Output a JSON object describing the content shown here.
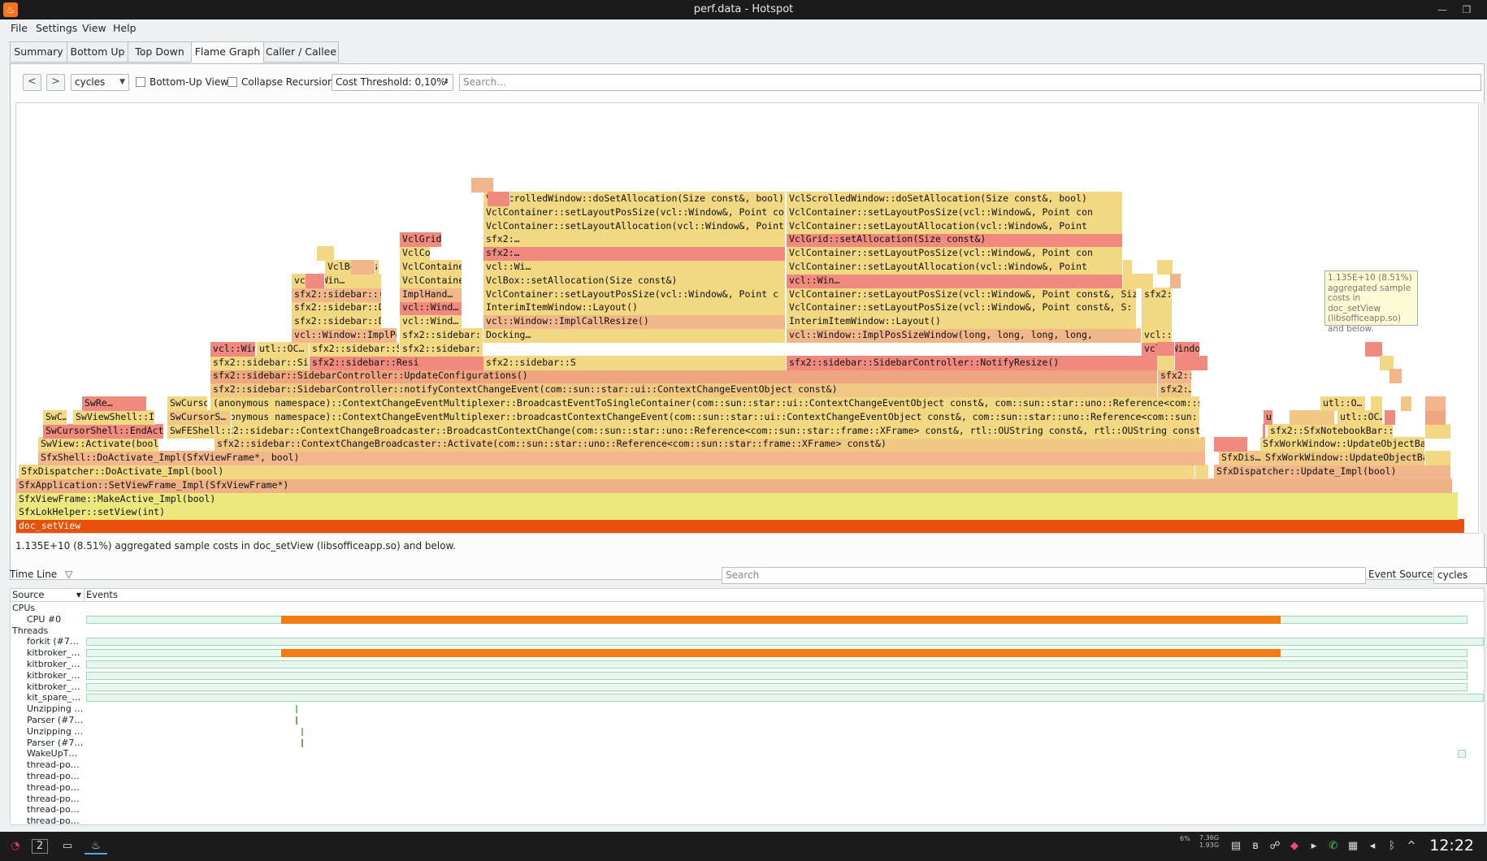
{
  "window": {
    "title": "perf.data - Hotspot"
  },
  "menubar": {
    "items": [
      "File",
      "Settings",
      "View",
      "Help"
    ]
  },
  "tabs": [
    "Summary",
    "Bottom Up",
    "Top Down",
    "Flame Graph",
    "Caller / Callee"
  ],
  "active_tab": "Flame Graph",
  "toolbar": {
    "back": "<",
    "forward": ">",
    "cost_type": "cycles",
    "bottom_up_view": "Bottom-Up View",
    "collapse_recursion": "Collapse Recursion",
    "cost_threshold": "Cost Threshold: 0,10%",
    "search_placeholder": "Search..."
  },
  "flamegraph": {
    "frames": [
      {
        "label": "doc_setView",
        "color": "#e8500c"
      },
      {
        "label": "SfxLokHelper::setView(int)",
        "color": "#ede87e"
      },
      {
        "label": "SfxViewFrame::MakeActive_Impl(bool)",
        "color": "#ede87e"
      },
      {
        "label": "SfxApplication::SetViewFrame_Impl(SfxViewFrame*)",
        "color": "#efb288"
      },
      {
        "label": "SfxDispatcher::DoActivate_Impl(bool)",
        "color": "#f2d882"
      },
      {
        "label": "SfxDispatcher::Update_Impl(bool)",
        "color": "#f1b68a"
      },
      {
        "label": "SfxShell::DoActivate_Impl(SfxViewFrame*, bool)",
        "color": "#f1b68a"
      },
      {
        "label": "sfx2::sidebar::ContextChangeBroadcaster::Activate(com::sun::star::uno::Reference<com::sun::star::frame::XFrame> const&)",
        "color": "#f1c784"
      },
      {
        "label": "SwView::Activate(bool)",
        "color": "#f2d882"
      },
      {
        "label": "SfxDis…",
        "color": "#f1c784"
      },
      {
        "label": "SfxWorkWindow::UpdateObjectBa…",
        "color": "#f1c784"
      },
      {
        "label": "SfxWorkWindow::UpdateObjectBa…",
        "color": "#f2d882"
      },
      {
        "label": "sfx2::sidebar::ContextChangeBroadcaster::BroadcastContextChange(com::sun::star::uno::Reference<com::sun::star::frame::XFrame> const&, rtl::OUString const&, rtl::OUString const&)",
        "color": "#f2d882"
      },
      {
        "label": "SwCursorShell::EndActic",
        "color": "#f08a7e"
      },
      {
        "label": "SwFEShell::…",
        "color": "#f2d882"
      },
      {
        "label": "sfx2::SfxNotebookBar::IsActive",
        "color": "#f2d882"
      },
      {
        "label": "(anonymous namespace)::ContextChangeEventMultiplexer::broadcastContextChangeEvent(com::sun::star::ui::ContextChangeEventObject const&, com::sun::star::uno::Reference<com::sun::star",
        "color": "#f2d882"
      },
      {
        "label": "SwC…",
        "color": "#f2d882"
      },
      {
        "label": "SwViewShell::I…",
        "color": "#f2d882"
      },
      {
        "label": "SwCursorS…",
        "color": "#f1c784"
      },
      {
        "label": "utl::…",
        "color": "#f08a7e"
      },
      {
        "label": "utl::OC…",
        "color": "#f2d882"
      },
      {
        "label": "(anonymous namespace)::ContextChangeEventMultiplexer::BroadcastEventToSingleContainer(com::sun::star::ui::ContextChangeEventObject const&, com::sun::star::uno::Reference<com::sun::s",
        "color": "#f2d882"
      },
      {
        "label": "SwRe…",
        "color": "#f08a7e"
      },
      {
        "label": "SwCursorS…",
        "color": "#f2d882"
      },
      {
        "label": "utl::O…",
        "color": "#f2d882"
      },
      {
        "label": "sfx2::sidebar::SidebarController::notifyContextChangeEvent(com::sun::star::ui::ContextChangeEventObject const&)",
        "color": "#f1c784"
      },
      {
        "label": "sfx2:…",
        "color": "#f1c784"
      },
      {
        "label": "sfx2::sidebar::SidebarController::UpdateConfigurations()",
        "color": "#efa57e"
      },
      {
        "label": "sfx2::sidebar::Resi",
        "color": "#f1b68a"
      },
      {
        "label": "sfx2::sidebar::SidebarController::SwitchToDeck(sfx2::sidebar::DeckDescriptor const&, sfx2::sidebar::Context const&)",
        "color": "#f2d882"
      },
      {
        "label": "sfx2::sidebar::Resi",
        "color": "#f08a7e"
      },
      {
        "label": "sfx2::sidebar::S",
        "color": "#f2d882"
      },
      {
        "label": "sfx2::sidebar::SidebarController::NotifyResize()",
        "color": "#f08a7e"
      },
      {
        "label": "vcl::Window::setPosSizePixel(long, long, long, long, PosSizeFlag",
        "color": "#f08a7e"
      },
      {
        "label": "utl::OC…",
        "color": "#f2d882"
      },
      {
        "label": "sfx2::sidebar::S",
        "color": "#f2d882"
      },
      {
        "label": "sfx2::sidebar:",
        "color": "#f2d882"
      },
      {
        "label": "vcl::Window::setPosSizePixel(long, long, long, long, Po",
        "color": "#f08a7e"
      },
      {
        "label": "vcl::Window::ImplPosSizeWindow(long, long, long, long, PosSizeF",
        "color": "#f1b68a"
      },
      {
        "label": "sfx2::sidebar::D",
        "color": "#f2d882"
      },
      {
        "label": "Docking…",
        "color": "#f2d882"
      },
      {
        "label": "vcl::Window::ImplPosSizeWindow(long, long, long, long,",
        "color": "#f1b68a"
      },
      {
        "label": "vcl::Window::ImplCallResize()",
        "color": "#f2d882"
      },
      {
        "label": "sfx2::sidebar::D",
        "color": "#f2d882"
      },
      {
        "label": "vcl::Wind…",
        "color": "#f2d882"
      },
      {
        "label": "vcl::Window::ImplCallResize()",
        "color": "#f1b68a"
      },
      {
        "label": "InterimItemWindow::Layout()",
        "color": "#f2d882"
      },
      {
        "label": "sfx2::sidebar::D",
        "color": "#f2d882"
      },
      {
        "label": "vcl::Wind…",
        "color": "#f08a7e"
      },
      {
        "label": "InterimItemWindow::Layout()",
        "color": "#f2d882"
      },
      {
        "label": "VclContainer::setLayoutPosSize(vcl::Window&, Point const&, S:",
        "color": "#f2d882"
      },
      {
        "label": "sfx2::sidebar::(",
        "color": "#f1b68a"
      },
      {
        "label": "ImplHand…",
        "color": "#f1b68a"
      },
      {
        "label": "VclContainer::setLayoutPosSize(vcl::Window&, Point c",
        "color": "#f2d882"
      },
      {
        "label": "VclContainer::setLayoutPosSize(vcl::Window&, Point const&, Size",
        "color": "#f2d882"
      },
      {
        "label": "sfx2:…",
        "color": "#f2d882"
      },
      {
        "label": "vcl::Win…",
        "color": "#f2d882"
      },
      {
        "label": "VclContainer::setLayoutPosSize(vcl::Window&, Point cons",
        "color": "#f2d882"
      },
      {
        "label": "VclBox::setAllocation(Size const&)",
        "color": "#f2d882"
      },
      {
        "label": "vcl::Win…",
        "color": "#f08a7e"
      },
      {
        "label": "VclBox::setAllocation(Size const&)",
        "color": "#f2d882"
      },
      {
        "label": "VclContainer::setLayoutAllocation(vcl::Window&, Point const&, !",
        "color": "#f2d882"
      },
      {
        "label": "vcl::Wi…",
        "color": "#f2d882"
      },
      {
        "label": "VclContainer::setLayoutAllocation(vcl::Window&, Point",
        "color": "#f2d882"
      },
      {
        "label": "VclContainer::setLayoutPosSize(vcl::Window&, Point const&, Siz",
        "color": "#f2d882"
      },
      {
        "label": "sfx2:…",
        "color": "#f08a7e"
      },
      {
        "label": "VclContainer::setLayoutPosSize(vcl::Window&, Point con",
        "color": "#f2d882"
      },
      {
        "label": "VclGrid::setAllocation(Size const&)",
        "color": "#f08a7e"
      },
      {
        "label": "sfx2:…",
        "color": "#f2d882"
      },
      {
        "label": "VclGrid::setAllocation(Size const&)",
        "color": "#f08a7e"
      },
      {
        "label": "VclContainer::setLayoutAllocation(vcl::Window&, Point const&, !",
        "color": "#f2d882"
      },
      {
        "label": "VclContainer::setLayoutAllocation(vcl::Window&, Point",
        "color": "#f2d882"
      },
      {
        "label": "VclContainer::setLayoutPosSize(vcl::Window&, Point const&, Siz",
        "color": "#f2d882"
      },
      {
        "label": "VclContainer::setLayoutPosSize(vcl::Window&, Point con",
        "color": "#f2d882"
      },
      {
        "label": "VclScrolledWindow::doSetAllocation(Size const&, bool)",
        "color": "#f2d882"
      },
      {
        "label": "VclScrolledWindow::doSetAllocation(Size const&, bool)",
        "color": "#f2d882"
      },
      {
        "label": "VclContainer::setLayoutAllocation(vcl::Window&, Point const&, !",
        "color": "#f1b68a"
      }
    ]
  },
  "tooltip": {
    "lines": [
      "1.135E+10 (8.51%)",
      "aggregated sample",
      "costs in doc_setView",
      "(libsofficeapp.so)",
      "and below."
    ]
  },
  "status": "1.135E+10 (8.51%) aggregated sample costs in doc_setView (libsofficeapp.so) and below.",
  "timeline": {
    "label": "Time Line",
    "search_placeholder": "Search",
    "event_source_label": "Event Source:",
    "event_source": "cycles",
    "col_source": "Source",
    "col_events": "Events",
    "rows": [
      {
        "name": "CPUs",
        "indent": 0
      },
      {
        "name": "CPU #0",
        "indent": 1
      },
      {
        "name": "Threads",
        "indent": 0
      },
      {
        "name": "forkit (#7…",
        "indent": 1
      },
      {
        "name": "kitbroker_…",
        "indent": 1
      },
      {
        "name": "kitbroker_…",
        "indent": 1
      },
      {
        "name": "kitbroker_…",
        "indent": 1
      },
      {
        "name": "kitbroker_…",
        "indent": 1
      },
      {
        "name": "kit_spare_…",
        "indent": 1
      },
      {
        "name": "Unzipping …",
        "indent": 1
      },
      {
        "name": "Parser (#7…",
        "indent": 1
      },
      {
        "name": "Unzipping …",
        "indent": 1
      },
      {
        "name": "Parser (#7…",
        "indent": 1
      },
      {
        "name": "WakeUpT…",
        "indent": 1
      },
      {
        "name": "thread-po…",
        "indent": 1
      },
      {
        "name": "thread-po…",
        "indent": 1
      },
      {
        "name": "thread-po…",
        "indent": 1
      },
      {
        "name": "thread-po…",
        "indent": 1
      },
      {
        "name": "thread-po…",
        "indent": 1
      },
      {
        "name": "thread-po…",
        "indent": 1
      }
    ]
  },
  "taskbar": {
    "workspace": "2",
    "clock": "12:22",
    "cpu": "6%",
    "mem_top": "7.36G",
    "mem_bottom": "1.93G"
  }
}
